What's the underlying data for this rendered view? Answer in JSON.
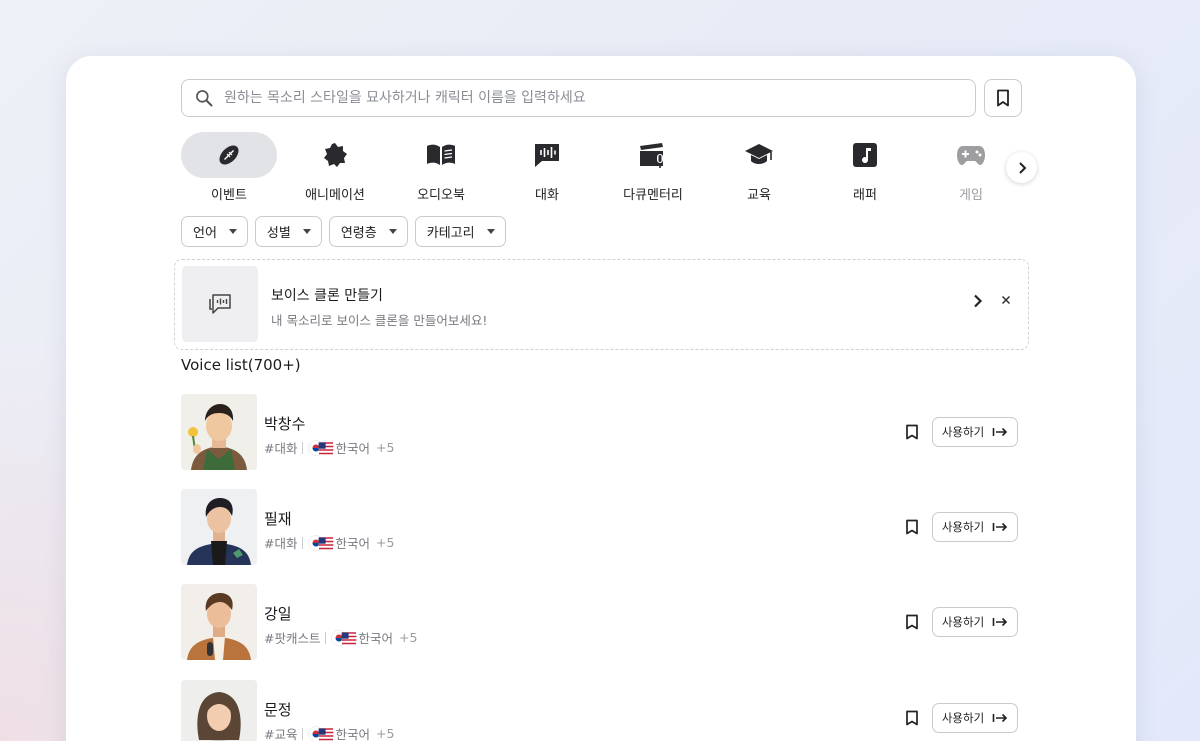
{
  "search": {
    "placeholder": "원하는 목소리 스타일을 묘사하거나 캐릭터 이름을 입력하세요"
  },
  "categories": [
    {
      "label": "이벤트",
      "icon": "football-icon",
      "active": true
    },
    {
      "label": "애니메이션",
      "icon": "starburst-badge-icon",
      "active": false
    },
    {
      "label": "오디오북",
      "icon": "open-book-icon",
      "active": false
    },
    {
      "label": "대화",
      "icon": "chat-waveform-icon",
      "active": false
    },
    {
      "label": "다큐멘터리",
      "icon": "clapperboard-mic-icon",
      "active": false
    },
    {
      "label": "교육",
      "icon": "graduation-cap-icon",
      "active": false
    },
    {
      "label": "래퍼",
      "icon": "music-note-icon",
      "active": false
    },
    {
      "label": "게임",
      "icon": "gamepad-icon",
      "active": false
    }
  ],
  "filters": [
    "언어",
    "성별",
    "연령층",
    "카테고리"
  ],
  "clone_banner": {
    "title": "보이스 클론 만들기",
    "subtitle": "내 목소리로 보이스 클론을 만들어보세요!"
  },
  "voice_list": {
    "title": "Voice list(700+)",
    "use_label": "사용하기",
    "items": [
      {
        "name": "박창수",
        "tag": "#대화",
        "language": "한국어",
        "more": "+5"
      },
      {
        "name": "필재",
        "tag": "#대화",
        "language": "한국어",
        "more": "+5"
      },
      {
        "name": "강일",
        "tag": "#팟캐스트",
        "language": "한국어",
        "more": "+5"
      },
      {
        "name": "문정",
        "tag": "#교육",
        "language": "한국어",
        "more": "+5"
      }
    ]
  },
  "colors": {
    "accent_active_pill": "#e2e3e6",
    "border": "#c9cbd1",
    "text_primary": "#1b1b1f",
    "text_secondary": "#777a80"
  }
}
